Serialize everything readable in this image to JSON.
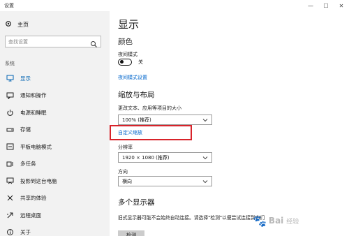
{
  "window": {
    "title": "设置",
    "controls": {
      "minimize": "—",
      "maximize": "☐",
      "close": "✕"
    }
  },
  "sidebar": {
    "home_label": "主页",
    "search_placeholder": "查找设置",
    "section_label": "系统",
    "items": [
      {
        "label": "显示",
        "icon": "monitor-icon",
        "active": true
      },
      {
        "label": "通知和操作",
        "icon": "notification-icon"
      },
      {
        "label": "电源和睡眠",
        "icon": "power-icon"
      },
      {
        "label": "存储",
        "icon": "storage-icon"
      },
      {
        "label": "平板电脑模式",
        "icon": "tablet-icon"
      },
      {
        "label": "多任务",
        "icon": "multitask-icon"
      },
      {
        "label": "投影到这台电脑",
        "icon": "project-icon"
      },
      {
        "label": "共享的体验",
        "icon": "share-icon"
      },
      {
        "label": "远程桌面",
        "icon": "remote-desktop-icon"
      },
      {
        "label": "关于",
        "icon": "info-icon"
      }
    ]
  },
  "main": {
    "page_title": "显示",
    "color": {
      "heading": "颜色",
      "night_mode_label": "夜间模式",
      "night_mode_state": "关",
      "night_mode_settings_link": "夜间模式设置"
    },
    "scale_layout": {
      "heading": "缩放与布局",
      "scale_label": "更改文本、应用等项目的大小",
      "scale_value": "100% (推荐)",
      "custom_scale_link": "自定义缩放",
      "resolution_label": "分辨率",
      "resolution_value": "1920 × 1080 (推荐)",
      "orientation_label": "方向",
      "orientation_value": "横向"
    },
    "multi_display": {
      "heading": "多个显示器",
      "description": "旧式显示器可能不会始终自动连接。请选择\"检测\"以便尝试连接到它们",
      "detect_button": "检测"
    },
    "watermark": {
      "text": "Bai",
      "sub": "经验"
    }
  },
  "colors": {
    "accent": "#0063b1",
    "link": "#0066cc",
    "highlight": "#d8232a",
    "sidebar_bg": "#f2f2f2"
  }
}
